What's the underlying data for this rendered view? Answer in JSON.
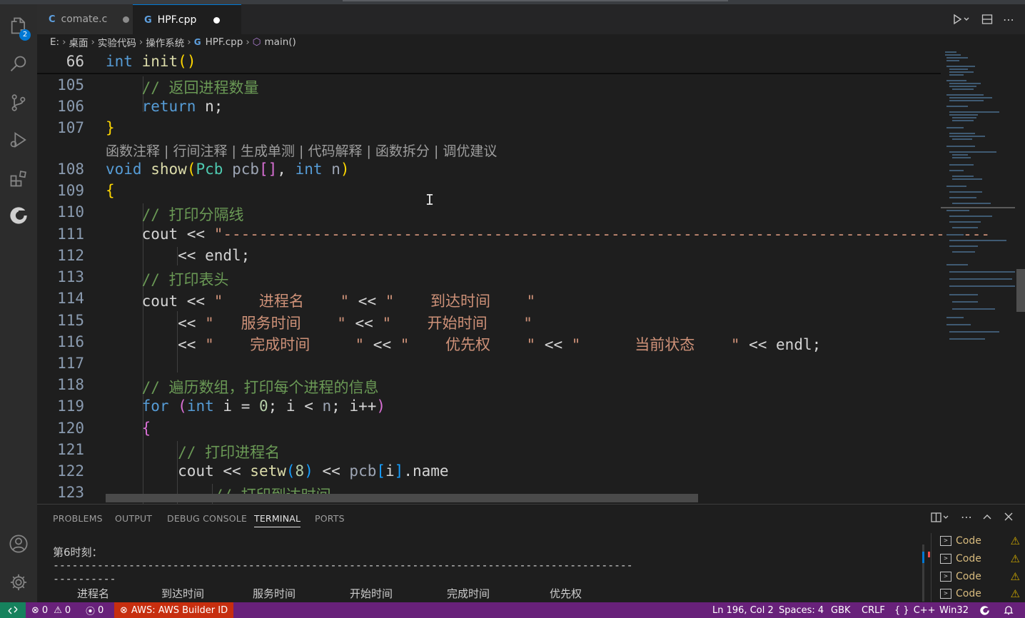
{
  "activity": {
    "explorer_badge": "2"
  },
  "tabs": [
    {
      "icon": "C",
      "label": "comate.c"
    },
    {
      "icon": "G",
      "label": "HPF.cpp"
    }
  ],
  "breadcrumb": [
    "E:",
    "桌面",
    "实验代码",
    "操作系统",
    "HPF.cpp",
    "main()"
  ],
  "editor": {
    "sticky_line": "66",
    "lines": [
      "105",
      "106",
      "107",
      "108",
      "109",
      "110",
      "111",
      "112",
      "113",
      "114",
      "115",
      "116",
      "117",
      "118",
      "119",
      "120",
      "121",
      "122",
      "123"
    ],
    "codelens": "函数注释 | 行间注释 | 生成单测 | 代码解释 | 函数拆分 | 调优建议",
    "comments": {
      "c105": "// 返回进程数量",
      "c110": "// 打印分隔线",
      "c113": "// 打印表头",
      "c118": "// 遍历数组，打印每个进程的信息",
      "c121": "// 打印进程名",
      "c123": "// 打印到达时间"
    },
    "strings": {
      "s114a": "\"    进程名    \"",
      "s114b": "\"    到达时间    \"",
      "s115a": "\"   服务时间    \"",
      "s115b": "\"    开始时间    \"",
      "s116a": "\"    完成时间     \"",
      "s116b": "\"    优先权    \"",
      "s116c": "\"      当前状态    \""
    }
  },
  "panel": {
    "tabs": [
      "PROBLEMS",
      "OUTPUT",
      "DEBUG CONSOLE",
      "TERMINAL",
      "PORTS"
    ],
    "active_tab": "TERMINAL",
    "terminal": {
      "line1": "第6时刻：",
      "headers": [
        "进程名",
        "到达时间",
        "服务时间",
        "开始时间",
        "完成时间",
        "优先权"
      ]
    },
    "terminals": [
      "Code",
      "Code",
      "Code",
      "Code"
    ]
  },
  "status": {
    "errors": "0",
    "warnings": "0",
    "ports": "0",
    "aws": "AWS: AWS Builder ID",
    "position": "Ln 196, Col 2",
    "spaces": "Spaces: 4",
    "encoding": "GBK",
    "eol": "CRLF",
    "language": "C++",
    "platform": "Win32"
  },
  "colors": {
    "status_bar": "#68217a",
    "aws_badge": "#c72e0f",
    "remote": "#16825d",
    "keyword": "#569cd6",
    "comment": "#6a9955",
    "string": "#ce9178"
  }
}
